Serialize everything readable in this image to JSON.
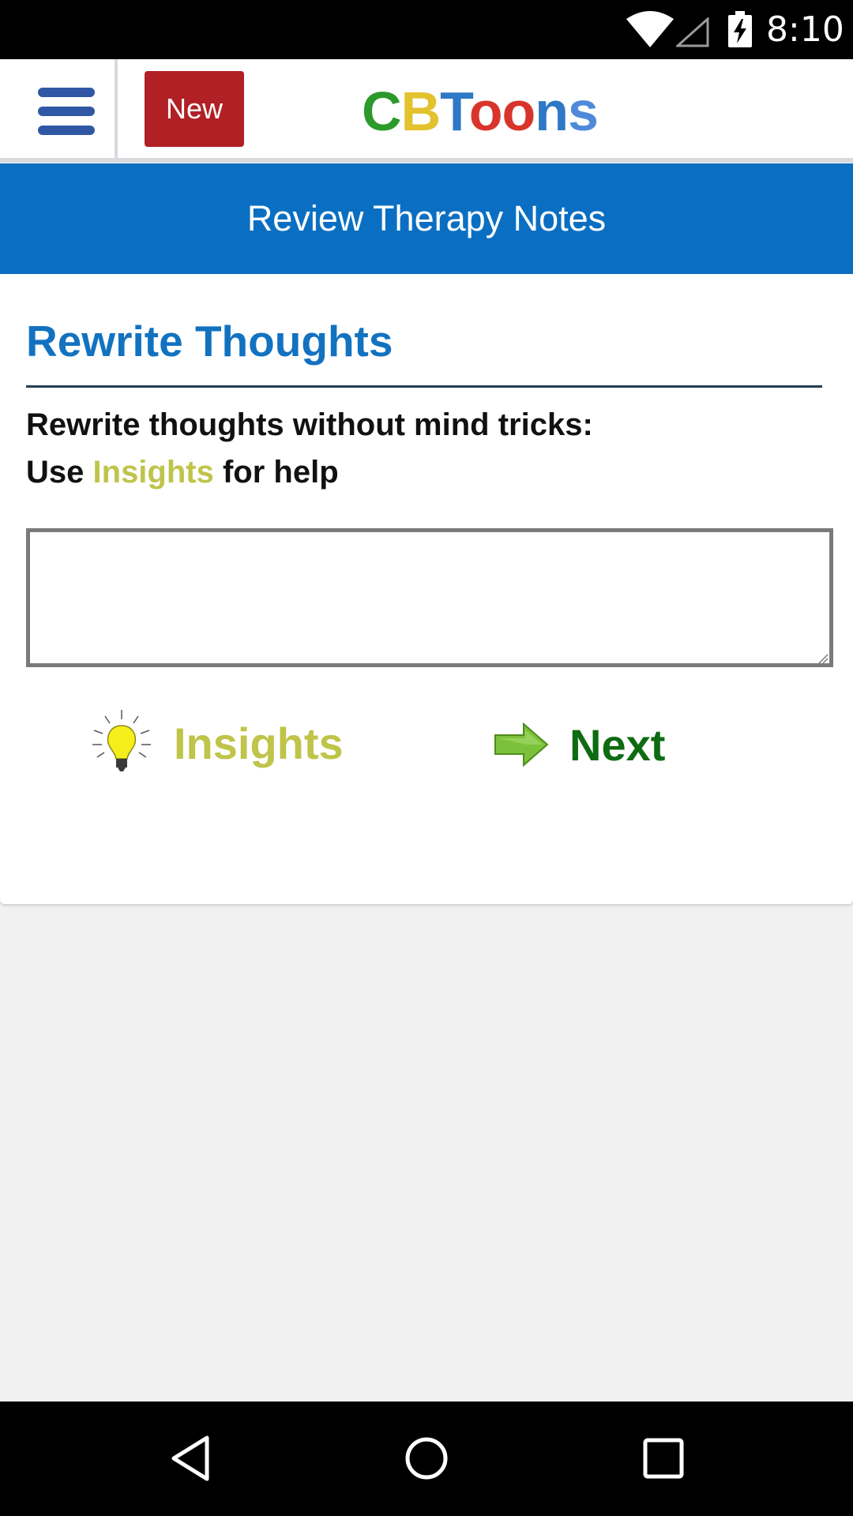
{
  "status_bar": {
    "time": "8:10",
    "icons": [
      "wifi-icon",
      "cell-signal-icon",
      "battery-charging-icon"
    ]
  },
  "header": {
    "menu_icon": "hamburger-menu-icon",
    "new_label": "New",
    "logo": {
      "text": "CBToons",
      "letters": [
        {
          "char": "C",
          "color": "#2b9a2b"
        },
        {
          "char": "B",
          "color": "#e2c22d"
        },
        {
          "char": "T",
          "color": "#2e78c6"
        },
        {
          "char": "o",
          "color": "#d9342b"
        },
        {
          "char": "o",
          "color": "#d9342b"
        },
        {
          "char": "n",
          "color": "#2e78c6"
        },
        {
          "char": "s",
          "color": "#4f8ad9"
        }
      ]
    }
  },
  "banner": {
    "title": "Review Therapy Notes"
  },
  "card": {
    "section_title": "Rewrite Thoughts",
    "instruction_line1": "Rewrite thoughts without mind tricks:",
    "instruction_line2_prefix": "Use",
    "instruction_line2_highlight": "Insights",
    "instruction_line2_suffix": "for help",
    "thought_input": {
      "value": "",
      "placeholder": ""
    },
    "insights_label": "Insights",
    "insights_icon": "lightbulb-icon",
    "next_label": "Next",
    "next_icon": "right-arrow-icon"
  },
  "nav_bar": {
    "icons": [
      "back-icon",
      "home-icon",
      "recents-icon"
    ]
  },
  "colors": {
    "banner": "#0a6fc2",
    "new_button": "#b02024",
    "title_blue": "#1272c0",
    "insights_yellow": "#bfc44a",
    "next_green": "#0f6b12",
    "menu_blue": "#2f57a4"
  }
}
